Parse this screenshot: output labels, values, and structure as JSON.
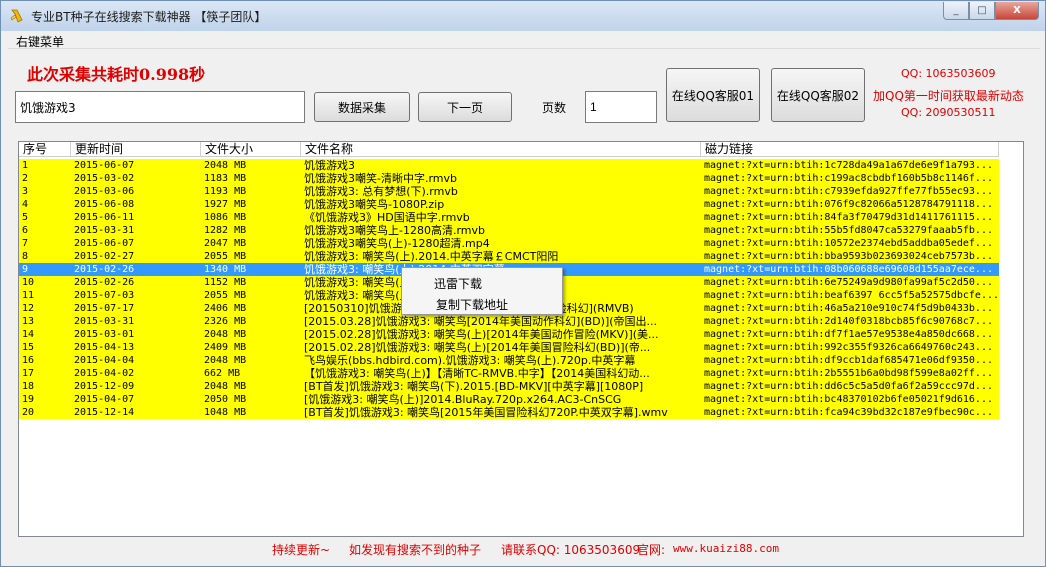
{
  "window": {
    "title": "专业BT种子在线搜索下载神器 【筷子团队】",
    "minimize": "_",
    "maximize": "□",
    "close": "X"
  },
  "menu": {
    "right_click_menu": "右键菜单"
  },
  "status": {
    "elapsed": "此次采集共耗时0.998秒"
  },
  "search": {
    "value": "饥饿游戏3"
  },
  "buttons": {
    "collect": "数据采集",
    "next": "下一页",
    "qq1": "在线QQ客服01",
    "qq2": "在线QQ客服02"
  },
  "pages": {
    "label": "页数",
    "value": "1"
  },
  "contact": {
    "qq1": "QQ: 1063503609",
    "notice": "加QQ第一时间获取最新动态",
    "qq2": "QQ: 2090530511"
  },
  "table": {
    "headers": [
      "序号",
      "更新时间",
      "文件大小",
      "文件名称",
      "磁力链接"
    ],
    "selected_index": 8,
    "rows": [
      [
        "1",
        "2015-06-07",
        "2048 MB",
        "饥饿游戏3",
        "magnet:?xt=urn:btih:1c728da49a1a67de6e9f1a793..."
      ],
      [
        "2",
        "2015-03-02",
        "1183 MB",
        "饥饿游戏3嘲笑-清晰中字.rmvb",
        "magnet:?xt=urn:btih:c199ac8cbdbf160b5b8c1146f..."
      ],
      [
        "3",
        "2015-03-06",
        "1193 MB",
        "饥饿游戏3: 总有梦想(下).rmvb",
        "magnet:?xt=urn:btih:c7939efda927ffe77fb55ec93..."
      ],
      [
        "4",
        "2015-06-08",
        "1927 MB",
        "饥饿游戏3嘲笑鸟-1080P.zip",
        "magnet:?xt=urn:btih:076f9c82066a5128784791118..."
      ],
      [
        "5",
        "2015-06-11",
        "1086 MB",
        "《饥饿游戏3》HD国语中字.rmvb",
        "magnet:?xt=urn:btih:84fa3f70479d31d1411761115..."
      ],
      [
        "6",
        "2015-03-31",
        "1282 MB",
        "饥饿游戏3嘲笑鸟上-1280高清.rmvb",
        "magnet:?xt=urn:btih:55b5fd8047ca53279faaab5fb..."
      ],
      [
        "7",
        "2015-06-07",
        "2047 MB",
        "饥饿游戏3嘲笑鸟(上)-1280超清.mp4",
        "magnet:?xt=urn:btih:10572e2374ebd5addba05edef..."
      ],
      [
        "8",
        "2015-02-27",
        "2055 MB",
        "饥饿游戏3: 嘲笑鸟(上).2014.中英字幕￡CMCT阳阳",
        "magnet:?xt=urn:btih:bba9593b023693024ceb7573b..."
      ],
      [
        "9",
        "2015-02-26",
        "1340 MB",
        "饥饿游戏3: 嘲笑鸟(上).2014.中英双字幕",
        "magnet:?xt=urn:btih:08b060688e69608d155aa7ece..."
      ],
      [
        "10",
        "2015-02-26",
        "1152 MB",
        "饥饿游戏3: 嘲笑鸟(上).2014.中英字幕",
        "magnet:?xt=urn:btih:6e75249a9d980fa99af5c2d50..."
      ],
      [
        "11",
        "2015-07-03",
        "2055 MB",
        "饥饿游戏3: 嘲笑鸟(上).2014.中英字幕￡CMCT阳阳",
        "magnet:?xt=urn:btih:beaf6397 6cc5f5a52575dbcfe..."
      ],
      [
        "12",
        "2015-07-17",
        "2406 MB",
        "[20150310]饥饿游戏3: 嘲笑鸟(上)[2014年美国冒险科幻](RMVB)",
        "magnet:?xt=urn:btih:46a5a210e910c74f5d9b0433b..."
      ],
      [
        "13",
        "2015-03-31",
        "2326 MB",
        "[2015.03.28]饥饿游戏3: 嘲笑鸟[2014年美国动作科幻](BD)](帝国出...",
        "magnet:?xt=urn:btih:2d140f0318bcb85f6c90768c7..."
      ],
      [
        "14",
        "2015-03-01",
        "2048 MB",
        "[2015.02.28]饥饿游戏3: 嘲笑鸟(上)[2014年美国动作冒险(MKV)](美...",
        "magnet:?xt=urn:btih:df7f1ae57e9538e4a850dc668..."
      ],
      [
        "15",
        "2015-04-13",
        "2409 MB",
        "[2015.02.28]饥饿游戏3: 嘲笑鸟(上)[2014年美国冒险科幻(BD)](帝...",
        "magnet:?xt=urn:btih:992c355f9326ca6649760c243..."
      ],
      [
        "16",
        "2015-04-04",
        "2048 MB",
        "飞鸟娱乐(bbs.hdbird.com).饥饿游戏3: 嘲笑鸟(上).720p.中英字幕",
        "magnet:?xt=urn:btih:df9ccb1daf685471e06df9350..."
      ],
      [
        "17",
        "2015-04-02",
        "662 MB",
        "【饥饿游戏3: 嘲笑鸟(上)】【清晰TC-RMVB.中字】【2014美国科幻动...",
        "magnet:?xt=urn:btih:2b5551b6a0bd98f599e8a02ff..."
      ],
      [
        "18",
        "2015-12-09",
        "2048 MB",
        "[BT首发]饥饿游戏3: 嘲笑鸟(下).2015.[BD-MKV][中英字幕][1080P]",
        "magnet:?xt=urn:btih:dd6c5c5a5d0fa6f2a59ccc97d..."
      ],
      [
        "19",
        "2015-04-07",
        "2050 MB",
        "[饥饿游戏3: 嘲笑鸟(上)]2014.BluRay.720p.x264.AC3-CnSCG",
        "magnet:?xt=urn:btih:bc48370102b6fe05021f9d616..."
      ],
      [
        "20",
        "2015-12-14",
        "1048 MB",
        "[BT首发]饥饿游戏3: 嘲笑鸟[2015年美国冒险科幻720P.中英双字幕].wmv",
        "magnet:?xt=urn:btih:fca94c39bd32c187e9fbec90c..."
      ]
    ]
  },
  "context_menu": {
    "items": [
      "迅雷下载",
      "复制下载地址"
    ]
  },
  "footer": {
    "keep_updating": "持续更新~",
    "notice": "如发现有搜索不到的种子",
    "contact": "请联系QQ: 1063503609",
    "site_label": "官网: ",
    "site_url": "www.kuaizi88.com"
  },
  "colors": {
    "row_bg": "#ffff00",
    "selected_bg": "#3399ff",
    "accent_red": "#e00000"
  }
}
